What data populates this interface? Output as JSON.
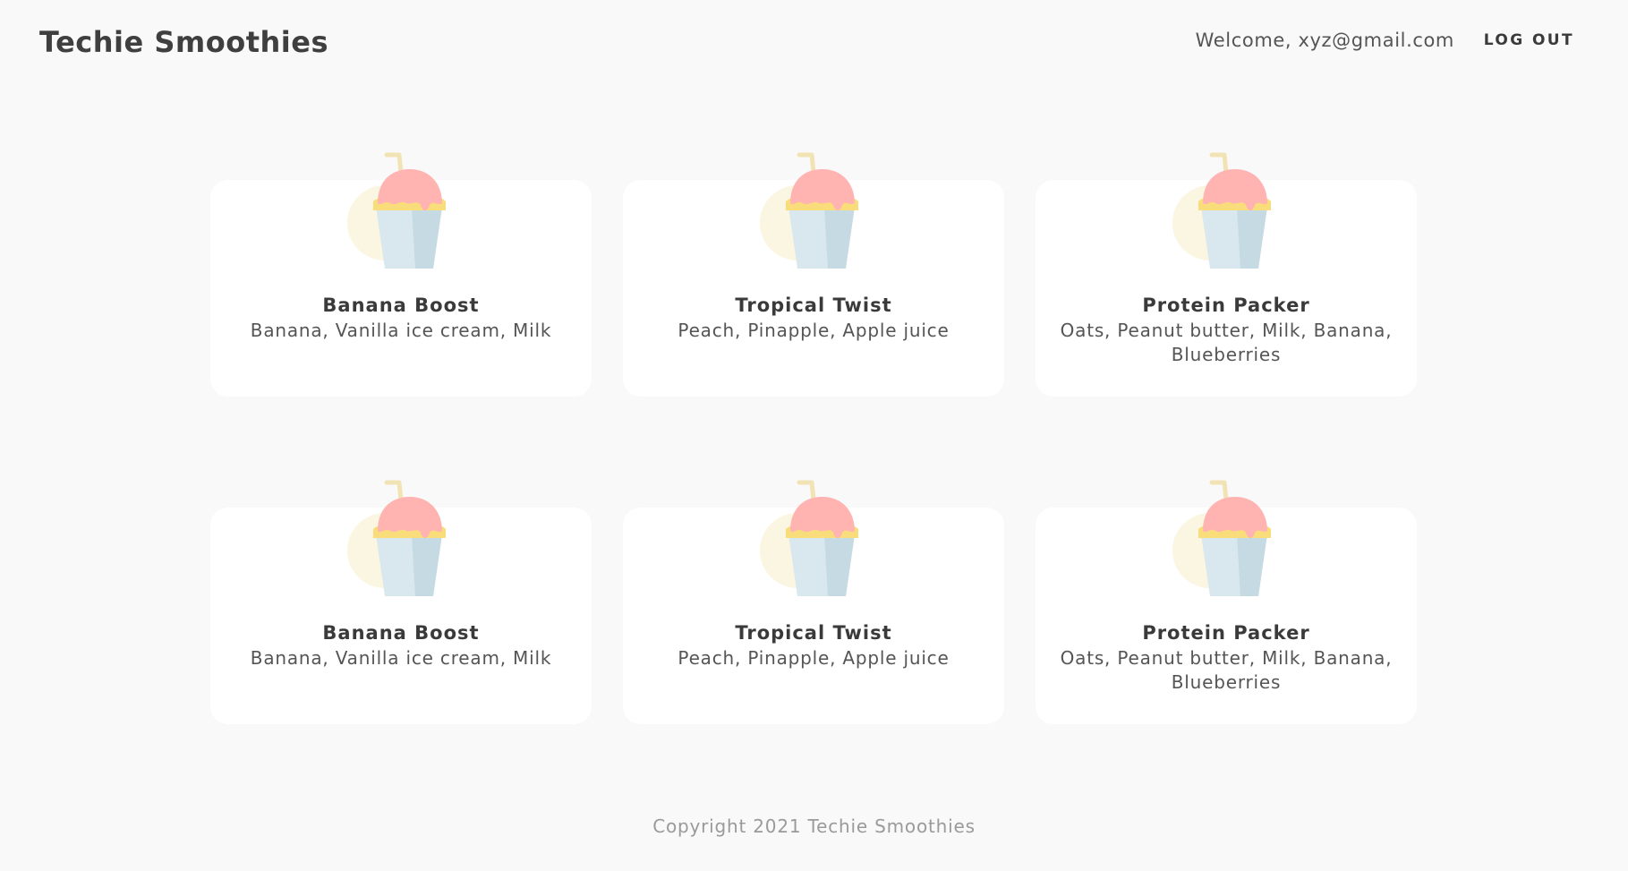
{
  "header": {
    "brand": "Techie Smoothies",
    "welcome": "Welcome, xyz@gmail.com",
    "logout_label": "LOG OUT"
  },
  "smoothies": [
    {
      "name": "Banana Boost",
      "ingredients": "Banana, Vanilla ice cream, Milk",
      "icon": "smoothie-cup-icon"
    },
    {
      "name": "Tropical Twist",
      "ingredients": "Peach, Pinapple, Apple juice",
      "icon": "smoothie-cup-icon"
    },
    {
      "name": "Protein Packer",
      "ingredients": "Oats, Peanut butter, Milk, Banana, Blueberries",
      "icon": "smoothie-cup-icon"
    },
    {
      "name": "Banana Boost",
      "ingredients": "Banana, Vanilla ice cream, Milk",
      "icon": "smoothie-cup-icon"
    },
    {
      "name": "Tropical Twist",
      "ingredients": "Peach, Pinapple, Apple juice",
      "icon": "smoothie-cup-icon"
    },
    {
      "name": "Protein Packer",
      "ingredients": "Oats, Peanut butter, Milk, Banana, Blueberries",
      "icon": "smoothie-cup-icon"
    }
  ],
  "footer": {
    "copyright": "Copyright 2021 Techie Smoothies"
  },
  "colors": {
    "background": "#f9f9f9",
    "card": "#ffffff",
    "cream": "#ffb4b2",
    "cup_light": "#d9e7ee",
    "cup_dark": "#c5dae3",
    "rim": "#f9dd7a",
    "straw": "#f2e3b5",
    "halo": "#fbf6e2"
  }
}
